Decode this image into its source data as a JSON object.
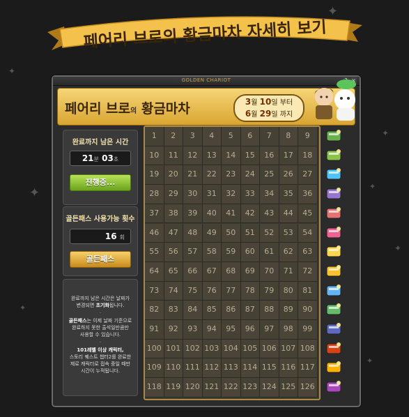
{
  "banner": {
    "title": "페어리 브로의 황금마차 자세히 보기"
  },
  "window": {
    "title": "GOLDEN CHARIOT",
    "help_label": "?",
    "close_label": "×"
  },
  "header": {
    "title_main": "페어리 브로",
    "title_particle": "의",
    "title_rest": "황금마차",
    "period_start_month": "3",
    "period_start_day": "10",
    "period_start_suffix": "부터",
    "period_end_month": "6",
    "period_end_day": "29",
    "period_end_suffix": "까지",
    "month_unit": "월",
    "day_unit": "일"
  },
  "timer": {
    "title": "완료까지 남은 시간",
    "minutes": "21",
    "minutes_unit": "분",
    "seconds": "03",
    "seconds_unit": "초",
    "button_label": "진행중..."
  },
  "goldpass": {
    "title": "골든패스 사용가능 횟수",
    "count": "16",
    "count_unit": "회",
    "button_label": "골든패스"
  },
  "notes": {
    "line1": "완료까지 남은 시간은 날짜가",
    "line2a": "변경되면 ",
    "line2b": "초기화",
    "line2c": "됩니다.",
    "line3a": "골든패스",
    "line3b": "는 이제 날짜 기준으로",
    "line4": "완료하지 못한 출석일만큼만",
    "line5": "사용할 수 있습니다.",
    "line6": "101레벨 이상 캐릭터,",
    "line7": "스토리 퀘스트 챕터2를 완료한",
    "line8": "제로 캐릭터로 접속 중일 때만",
    "line9": "시간이 누적됩니다.",
    "dot": "·"
  },
  "grid": {
    "columns": 9,
    "rows": 14,
    "days": [
      "1",
      "2",
      "3",
      "4",
      "5",
      "6",
      "7",
      "8",
      "9",
      "10",
      "11",
      "12",
      "13",
      "14",
      "15",
      "16",
      "17",
      "18",
      "19",
      "20",
      "21",
      "22",
      "23",
      "24",
      "25",
      "26",
      "27",
      "28",
      "29",
      "30",
      "31",
      "32",
      "33",
      "34",
      "35",
      "36",
      "37",
      "38",
      "39",
      "40",
      "41",
      "42",
      "43",
      "44",
      "45",
      "46",
      "47",
      "48",
      "49",
      "50",
      "51",
      "52",
      "53",
      "54",
      "55",
      "56",
      "57",
      "58",
      "59",
      "60",
      "61",
      "62",
      "63",
      "64",
      "65",
      "66",
      "67",
      "68",
      "69",
      "70",
      "71",
      "72",
      "73",
      "74",
      "75",
      "76",
      "77",
      "78",
      "79",
      "80",
      "81",
      "82",
      "83",
      "84",
      "85",
      "86",
      "87",
      "88",
      "89",
      "90",
      "91",
      "92",
      "93",
      "94",
      "95",
      "96",
      "97",
      "98",
      "99",
      "100",
      "101",
      "102",
      "103",
      "104",
      "105",
      "106",
      "107",
      "108",
      "109",
      "110",
      "111",
      "112",
      "113",
      "114",
      "115",
      "116",
      "117",
      "118",
      "119",
      "120",
      "121",
      "122",
      "123",
      "124",
      "125",
      "126"
    ]
  },
  "rewards": [
    {
      "icon": "green-ticket-icon",
      "color": "#6ab04c"
    },
    {
      "icon": "green-voucher-icon",
      "color": "#8bc34a"
    },
    {
      "icon": "blue-ticket-icon",
      "color": "#4fc3f7"
    },
    {
      "icon": "purple-ticket-icon",
      "color": "#9575cd"
    },
    {
      "icon": "scroll-icon",
      "color": "#e57373"
    },
    {
      "icon": "pink-coupon-icon",
      "color": "#f06292"
    },
    {
      "icon": "sparkle-box-icon",
      "color": "#ffd54f"
    },
    {
      "icon": "gold-card-icon",
      "color": "#fbc02d"
    },
    {
      "icon": "blue-card-icon",
      "color": "#64b5f6"
    },
    {
      "icon": "green-card-icon",
      "color": "#66bb6a"
    },
    {
      "icon": "blue-scroll-icon",
      "color": "#5c6bc0"
    },
    {
      "icon": "treasure-box-icon",
      "color": "#d84315"
    },
    {
      "icon": "gold-chest-icon",
      "color": "#ffb300"
    },
    {
      "icon": "sparkle-chest-icon",
      "color": "#ab47bc"
    }
  ]
}
